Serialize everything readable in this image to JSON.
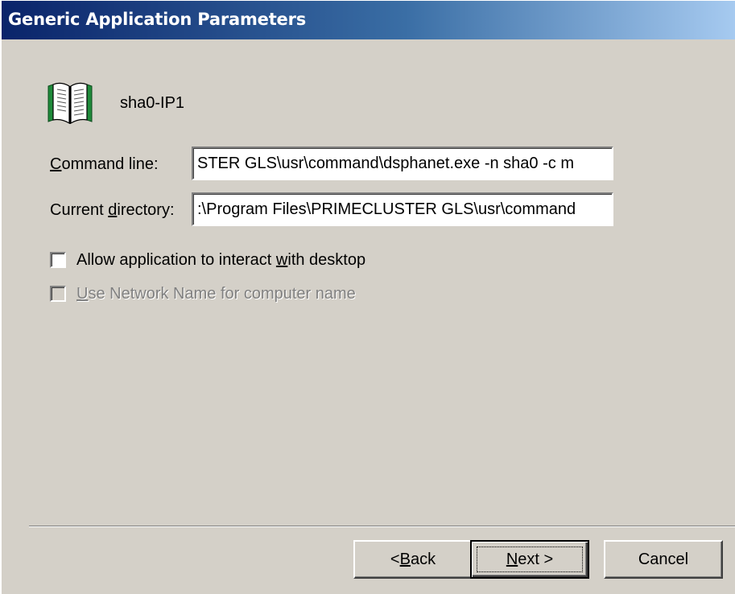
{
  "window": {
    "title": "Generic Application Parameters"
  },
  "app": {
    "icon": "open-book-icon",
    "name": "sha0-IP1"
  },
  "form": {
    "command_line": {
      "label_accel": "C",
      "label_rest": "ommand line:",
      "value": "STER GLS\\usr\\command\\dsphanet.exe -n sha0 -c m"
    },
    "current_directory": {
      "label_pre": "Current ",
      "label_accel": "d",
      "label_rest": "irectory:",
      "value": ":\\Program Files\\PRIMECLUSTER GLS\\usr\\command"
    },
    "allow_interact": {
      "label_pre": "Allow application to interact ",
      "label_accel": "w",
      "label_rest": "ith desktop",
      "checked": false
    },
    "use_network_name": {
      "label_accel": "U",
      "label_rest": "se Network Name for computer name",
      "checked": false,
      "disabled": true
    }
  },
  "buttons": {
    "back_pre": "< ",
    "back_accel": "B",
    "back_rest": "ack",
    "next_accel": "N",
    "next_rest": "ext >",
    "cancel": "Cancel"
  },
  "colors": {
    "title_gradient_start": "#0a246a",
    "title_gradient_end": "#a6caf0",
    "face": "#d4d0c8",
    "book_green": "#1f8a3a"
  }
}
